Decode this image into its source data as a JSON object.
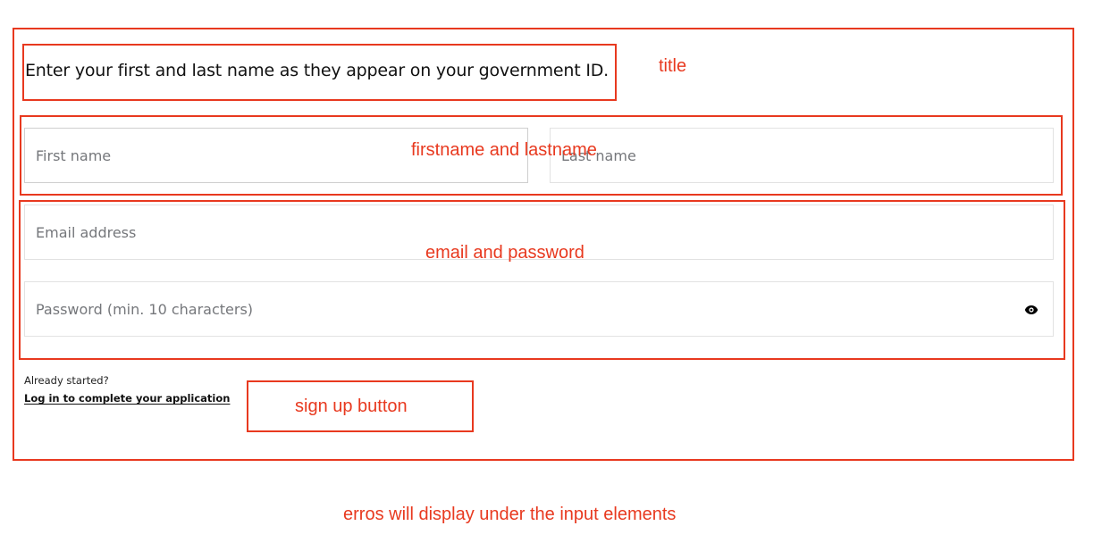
{
  "title": "Enter your first and last name as they appear on your government ID.",
  "form": {
    "first_name_placeholder": "First name",
    "last_name_placeholder": "Last name",
    "email_placeholder": "Email address",
    "password_placeholder": "Password (min. 10 characters)",
    "password_toggle_icon": "eye-icon"
  },
  "footer": {
    "already_started": "Already started?",
    "login_link": "Log in to complete your application"
  },
  "annotations": {
    "title": "title",
    "names": "firstname and lastname",
    "email_password": "email and password",
    "signup_button": "sign up button",
    "errors_note": "erros will display under the input elements"
  },
  "colors": {
    "annotation": "#e8391f",
    "field_border": "#e2e2e2",
    "placeholder": "#75777b"
  }
}
